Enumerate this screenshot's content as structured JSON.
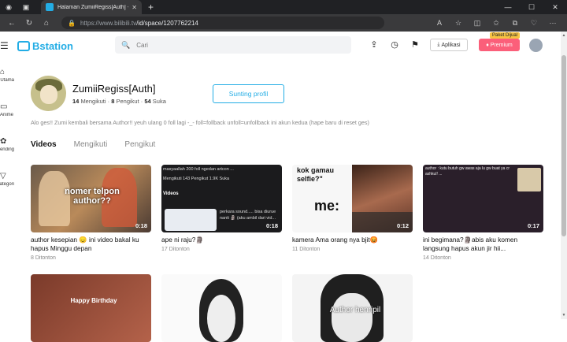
{
  "browser": {
    "tab_title": "Halaman ZumiiRegiss[Auth] - Bst",
    "url_prefix": "https://www.bilibili.tv",
    "url_path": "/id/space/1207762214"
  },
  "header": {
    "logo_text": "Bstation",
    "search_placeholder": "Cari",
    "app_label": "Aplikasi",
    "premium_label": "Premium",
    "premium_badge": "Paket Dijual"
  },
  "sidebar": {
    "items": [
      {
        "label": "Halaman Utama",
        "icon": "home-icon"
      },
      {
        "label": "Anime",
        "icon": "tv-icon"
      },
      {
        "label": "Trending",
        "icon": "fire-icon"
      },
      {
        "label": "Kategori",
        "icon": "filter-icon"
      }
    ]
  },
  "profile": {
    "name": "ZumiiRegiss[Auth]",
    "following_count": "14",
    "following_label": "Mengikuti",
    "followers_count": "8",
    "followers_label": "Pengikut",
    "likes_count": "54",
    "likes_label": "Suka",
    "edit_label": "Sunting profil",
    "bio": "Alo ges!! Zumi kembali bersama Author!! yeuh ulang 0 foll lagi -_- foll=follback unfoll=unfollback ini akun kedua (hape baru di reset ges)"
  },
  "tabs": [
    "Videos",
    "Mengikuti",
    "Pengikut"
  ],
  "videos": [
    {
      "title": "author kesepian 😞 ini video bakal ku hapus Minggu depan",
      "views": "8 Ditonton",
      "duration": "0:18",
      "overlay": "nomer telpon author??"
    },
    {
      "title": "ape ni raju?🗿",
      "views": "17 Ditonton",
      "duration": "0:18",
      "overlay": ""
    },
    {
      "title": "kamera Ama orang nya bjit😡",
      "views": "11 Ditonton",
      "duration": "0:12",
      "overlay": "me:"
    },
    {
      "title": "ini begimana?🗿abis aku komen langsung hapus akun jir hii...",
      "views": "14 Ditonton",
      "duration": "0:17",
      "overlay": ""
    },
    {
      "title": "",
      "views": "",
      "duration": "",
      "overlay": "Happy Birthday"
    },
    {
      "title": "",
      "views": "",
      "duration": "",
      "overlay": ""
    },
    {
      "title": "",
      "views": "",
      "duration": "",
      "overlay": "Author henripil"
    }
  ],
  "thumb_text": {
    "v2_header": "masyaallah 200 foll ngedan artcon ...",
    "v2_stats": "Mengikuti  143 Pengikut  1.9K Suka",
    "v2_tab": "Videos",
    "v2_caption": "perkara sound..... bisa diurue nanti 🗿 (aku ambil dari vid...",
    "v3_caption": "kok gamau selfie?\"",
    "v4_caption": "author : kutu butuh gw awas aja lu gw buat ya cr ashkul! ..."
  }
}
